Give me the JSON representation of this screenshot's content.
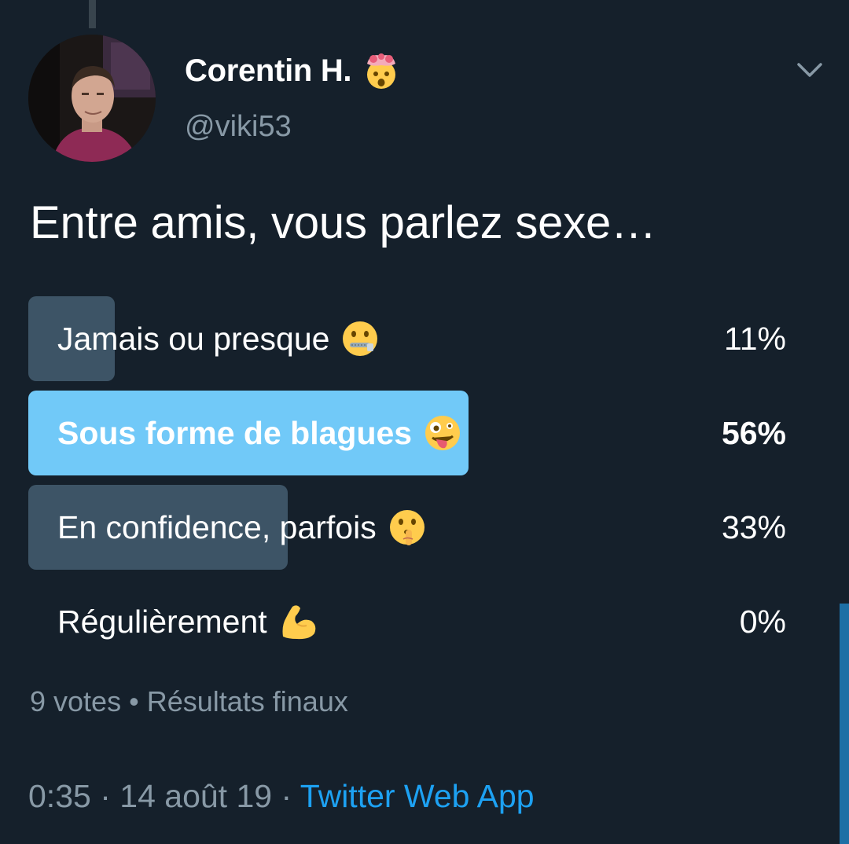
{
  "author": {
    "display_name": "Corentin H.",
    "name_emoji": "exploding-head-emoji",
    "handle": "@viki53"
  },
  "tweet": {
    "text": "Entre amis, vous parlez sexe…"
  },
  "poll": {
    "options": [
      {
        "label": "Jamais ou presque",
        "percent_label": "11%",
        "percent": 11,
        "emoji": "zipper-mouth-face-emoji",
        "winner": false
      },
      {
        "label": "Sous forme de blagues",
        "percent_label": "56%",
        "percent": 56,
        "emoji": "zany-face-emoji",
        "winner": true
      },
      {
        "label": "En confidence, parfois",
        "percent_label": "33%",
        "percent": 33,
        "emoji": "shushing-face-emoji",
        "winner": false
      },
      {
        "label": "Régulièrement",
        "percent_label": "0%",
        "percent": 0,
        "emoji": "flexed-biceps-emoji",
        "winner": false
      }
    ],
    "votes": "9 votes",
    "separator": "•",
    "status": "Résultats finaux"
  },
  "meta": {
    "time": "0:35",
    "dot1": "·",
    "date": "14 août 19",
    "dot2": "·",
    "source": "Twitter Web App"
  },
  "colors": {
    "background": "#15202b",
    "bar": "#3d5466",
    "winner_bar": "#71c9f8",
    "secondary_text": "#8899a6",
    "link": "#1da1f2"
  },
  "icons": {
    "menu": "chevron-down-icon"
  }
}
